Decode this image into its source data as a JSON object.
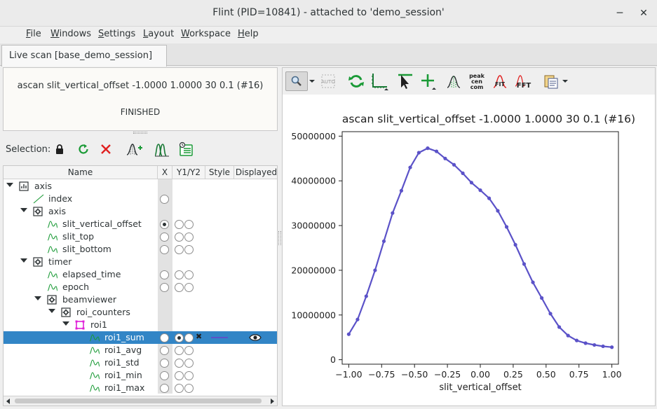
{
  "window": {
    "title": "Flint (PID=10841) - attached to 'demo_session'",
    "minimize": "─",
    "close": "✕"
  },
  "menu": [
    {
      "first": "F",
      "rest": "ile"
    },
    {
      "first": "W",
      "rest": "indows"
    },
    {
      "first": "S",
      "rest": "ettings"
    },
    {
      "first": "L",
      "rest": "ayout"
    },
    {
      "first": "W",
      "rest": "orkspace"
    },
    {
      "first": "H",
      "rest": "elp"
    }
  ],
  "tab": {
    "label": "Live scan [base_demo_session]"
  },
  "scan": {
    "command": "ascan slit_vertical_offset -1.0000 1.0000 30 0.1 (#16)",
    "state": "FINISHED"
  },
  "selection": {
    "label": "Selection:"
  },
  "tree": {
    "columns": [
      "Name",
      "X",
      "Y1/Y2",
      "Style",
      "Displayed"
    ],
    "rows": [
      {
        "name": "axis",
        "depth": 0,
        "expanded": true,
        "icon": "chart-icon",
        "x": false,
        "y": false
      },
      {
        "name": "index",
        "depth": 1,
        "icon": "line-icon",
        "x": true,
        "y": false
      },
      {
        "name": "axis",
        "depth": 1,
        "expanded": true,
        "icon": "device-icon",
        "x": false,
        "y": false
      },
      {
        "name": "slit_vertical_offset",
        "depth": 2,
        "icon": "signal-icon",
        "x": true,
        "xon": true,
        "y": true
      },
      {
        "name": "slit_top",
        "depth": 2,
        "icon": "signal-icon",
        "x": true,
        "y": true
      },
      {
        "name": "slit_bottom",
        "depth": 2,
        "icon": "signal-icon",
        "x": true,
        "y": true
      },
      {
        "name": "timer",
        "depth": 1,
        "expanded": true,
        "icon": "device-icon",
        "x": false,
        "y": false
      },
      {
        "name": "elapsed_time",
        "depth": 2,
        "icon": "signal-icon",
        "x": true,
        "y": true
      },
      {
        "name": "epoch",
        "depth": 2,
        "icon": "signal-icon",
        "x": true,
        "y": true
      },
      {
        "name": "beamviewer",
        "depth": 2,
        "expanded": true,
        "icon": "device-icon",
        "x": false,
        "y": false
      },
      {
        "name": "roi_counters",
        "depth": 3,
        "expanded": true,
        "icon": "device-icon",
        "x": false,
        "y": false
      },
      {
        "name": "roi1",
        "depth": 4,
        "expanded": true,
        "icon": "roi-icon",
        "x": false,
        "y": false
      },
      {
        "name": "roi1_sum",
        "depth": 5,
        "icon": "signal-icon",
        "x": true,
        "y": true,
        "y1on": true,
        "selected": true,
        "styled": true,
        "displayed": true
      },
      {
        "name": "roi1_avg",
        "depth": 5,
        "icon": "signal-icon",
        "x": true,
        "y": true
      },
      {
        "name": "roi1_std",
        "depth": 5,
        "icon": "signal-icon",
        "x": true,
        "y": true
      },
      {
        "name": "roi1_min",
        "depth": 5,
        "icon": "signal-icon",
        "x": true,
        "y": true
      },
      {
        "name": "roi1_max",
        "depth": 5,
        "icon": "signal-icon",
        "x": true,
        "y": true
      }
    ]
  },
  "plot_toolbar": {
    "auto": "AUTO",
    "peak": "peak\ncen\ncom",
    "fit": "FIT",
    "fft": "FFT"
  },
  "colors": {
    "series": "#5b52c8",
    "accent": "#1a9a36",
    "selection": "#3285c6",
    "danger": "#e02020"
  },
  "chart_data": {
    "type": "line",
    "title": "ascan slit_vertical_offset -1.0000 1.0000 30 0.1 (#16)",
    "xlabel": "slit_vertical_offset",
    "ylabel": "",
    "xlim": [
      -1.05,
      1.05
    ],
    "ylim": [
      -1000000,
      51000000
    ],
    "xticks": [
      -1.0,
      -0.75,
      -0.5,
      -0.25,
      0.0,
      0.25,
      0.5,
      0.75,
      1.0
    ],
    "xtick_labels": [
      "−1.00",
      "−0.75",
      "−0.50",
      "−0.25",
      "0.00",
      "0.25",
      "0.50",
      "0.75",
      "1.00"
    ],
    "yticks": [
      0,
      10000000,
      20000000,
      30000000,
      40000000,
      50000000
    ],
    "ytick_labels": [
      "0",
      "10000000",
      "20000000",
      "30000000",
      "40000000",
      "50000000"
    ],
    "grid": false,
    "series": [
      {
        "x": [
          -1.0,
          -0.933,
          -0.867,
          -0.8,
          -0.733,
          -0.667,
          -0.6,
          -0.533,
          -0.467,
          -0.4,
          -0.333,
          -0.267,
          -0.2,
          -0.133,
          -0.067,
          0.0,
          0.067,
          0.133,
          0.2,
          0.267,
          0.333,
          0.4,
          0.467,
          0.533,
          0.6,
          0.667,
          0.733,
          0.8,
          0.867,
          0.933,
          1.0
        ],
        "values": [
          5700000,
          9000000,
          14200000,
          20000000,
          26500000,
          32800000,
          37800000,
          43000000,
          46300000,
          47300000,
          46600000,
          45000000,
          43600000,
          41700000,
          39600000,
          37900000,
          36100000,
          33300000,
          29700000,
          25700000,
          21400000,
          17300000,
          13800000,
          10300000,
          7300000,
          5400000,
          4300000,
          3700000,
          3300000,
          3000000,
          2800000
        ]
      }
    ]
  }
}
